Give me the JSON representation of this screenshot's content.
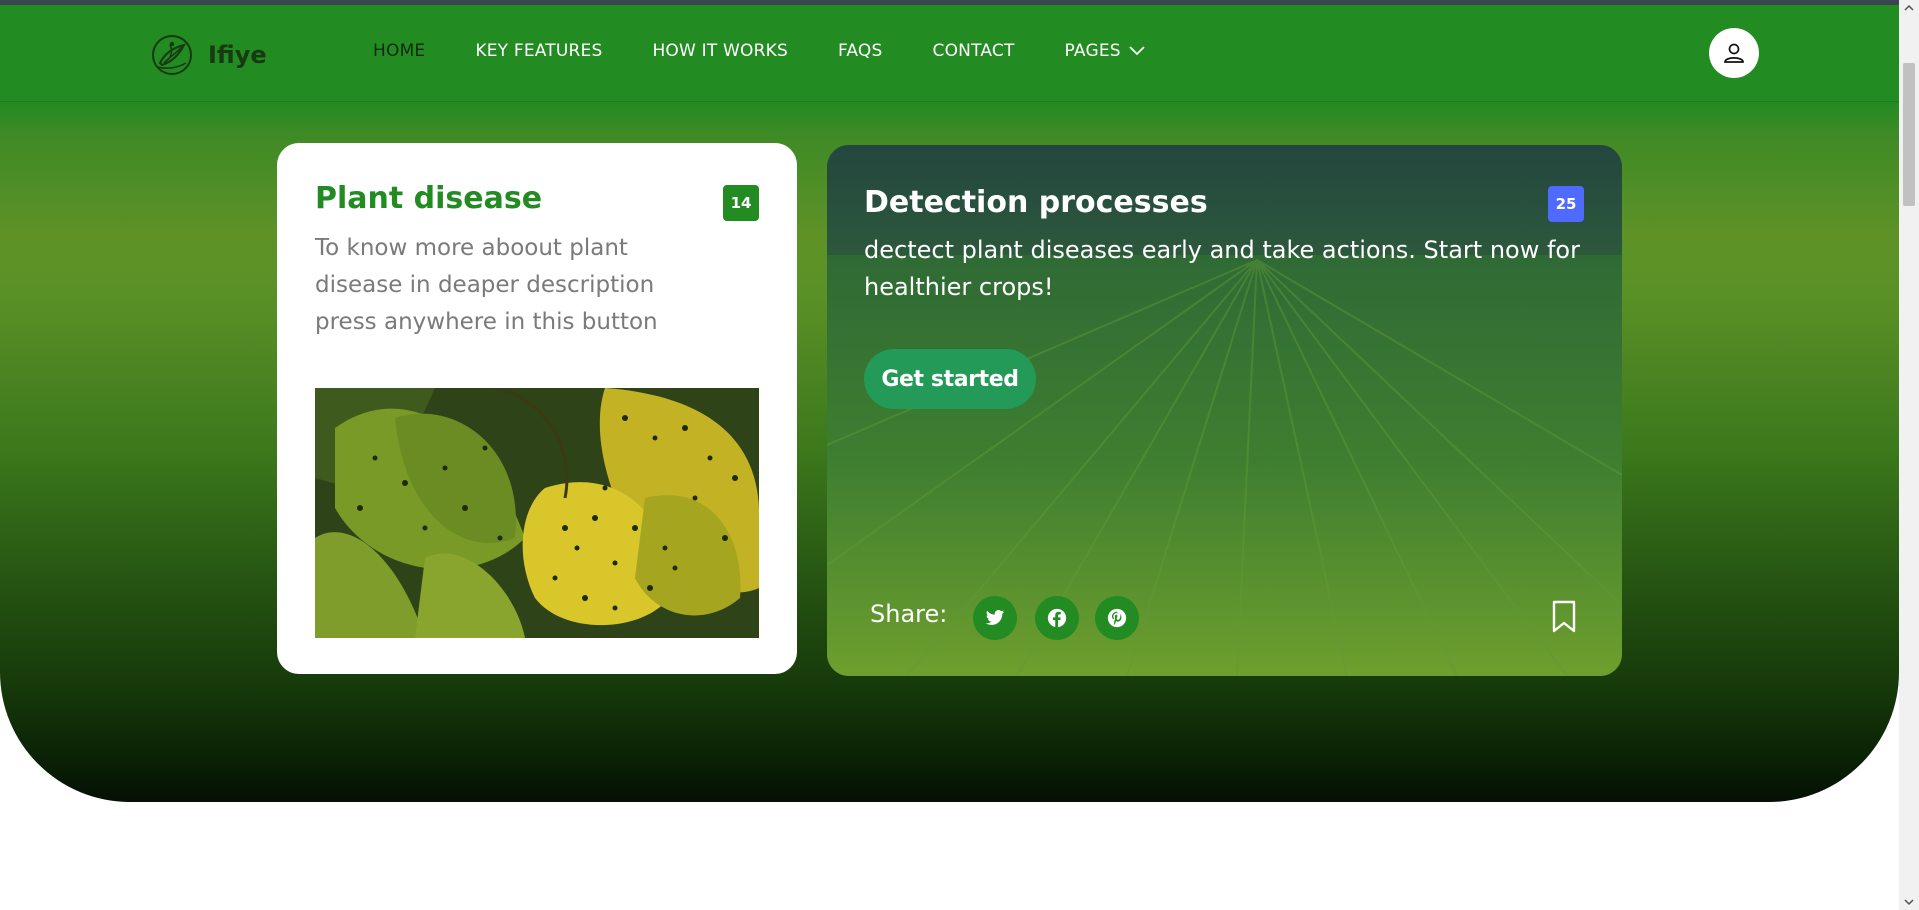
{
  "brand": {
    "name": "Ifiye",
    "logo_icon": "plant-leaf-logo-icon"
  },
  "nav": {
    "items": [
      {
        "label": "HOME",
        "active": true
      },
      {
        "label": "KEY FEATURES"
      },
      {
        "label": "HOW IT WORKS"
      },
      {
        "label": "FAQS"
      },
      {
        "label": "CONTACT"
      },
      {
        "label": "PAGES",
        "icon": "chevron-down-icon"
      }
    ],
    "user_icon": "user-icon"
  },
  "cards": {
    "plant_disease": {
      "title": "Plant disease",
      "badge": "14",
      "description": "To know more aboout plant disease in deaper description press anywhere in this button",
      "image": "yellow-diseased-leaves-photo"
    },
    "detection": {
      "title": "Detection processes",
      "badge": "25",
      "description": "dectect plant diseases early and take actions. Start now for healthier crops!",
      "cta_label": "Get started",
      "share_label": "Share:",
      "share_icons": [
        "twitter-icon",
        "facebook-icon",
        "pinterest-icon"
      ],
      "bookmark_icon": "bookmark-icon",
      "background": "green-crop-field-photo"
    }
  },
  "colors": {
    "primary": "#228b22",
    "badge_blue": "#4f6bff",
    "cta": "#239a57",
    "desc_gray": "#7a7a7a"
  }
}
